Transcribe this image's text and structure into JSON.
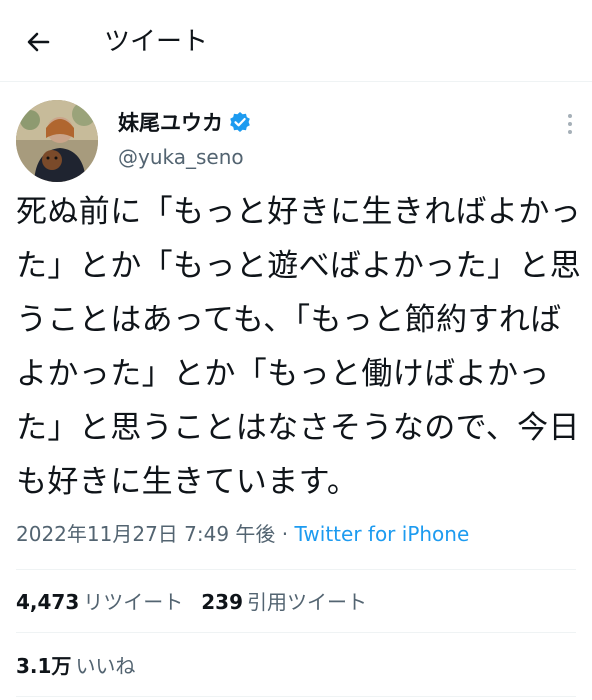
{
  "header": {
    "title": "ツイート",
    "back_icon": "arrow-left-icon"
  },
  "author": {
    "display_name": "妹尾ユウカ",
    "handle": "@yuka_seno",
    "verified": true,
    "verified_color": "#1d9bf0"
  },
  "tweet": {
    "text": "死ぬ前に「もっと好きに生きればよかった」とか「もっと遊べばよかった」と思うことはあっても、「もっと節約すればよかった」とか「もっと働けばよかった」と思うことはなさそうなので、今日も好きに生きています。"
  },
  "meta": {
    "timestamp": "2022年11月27日 7:49 午後",
    "separator": " · ",
    "source": "Twitter for iPhone"
  },
  "stats": {
    "retweets_count": "4,473",
    "retweets_label": "リツイート",
    "quotes_count": "239",
    "quotes_label": "引用ツイート",
    "likes_count": "3.1万",
    "likes_label": "いいね"
  },
  "colors": {
    "accent": "#1d9bf0",
    "text_primary": "#0f1419",
    "text_secondary": "#536471",
    "divider": "#eff3f4"
  }
}
